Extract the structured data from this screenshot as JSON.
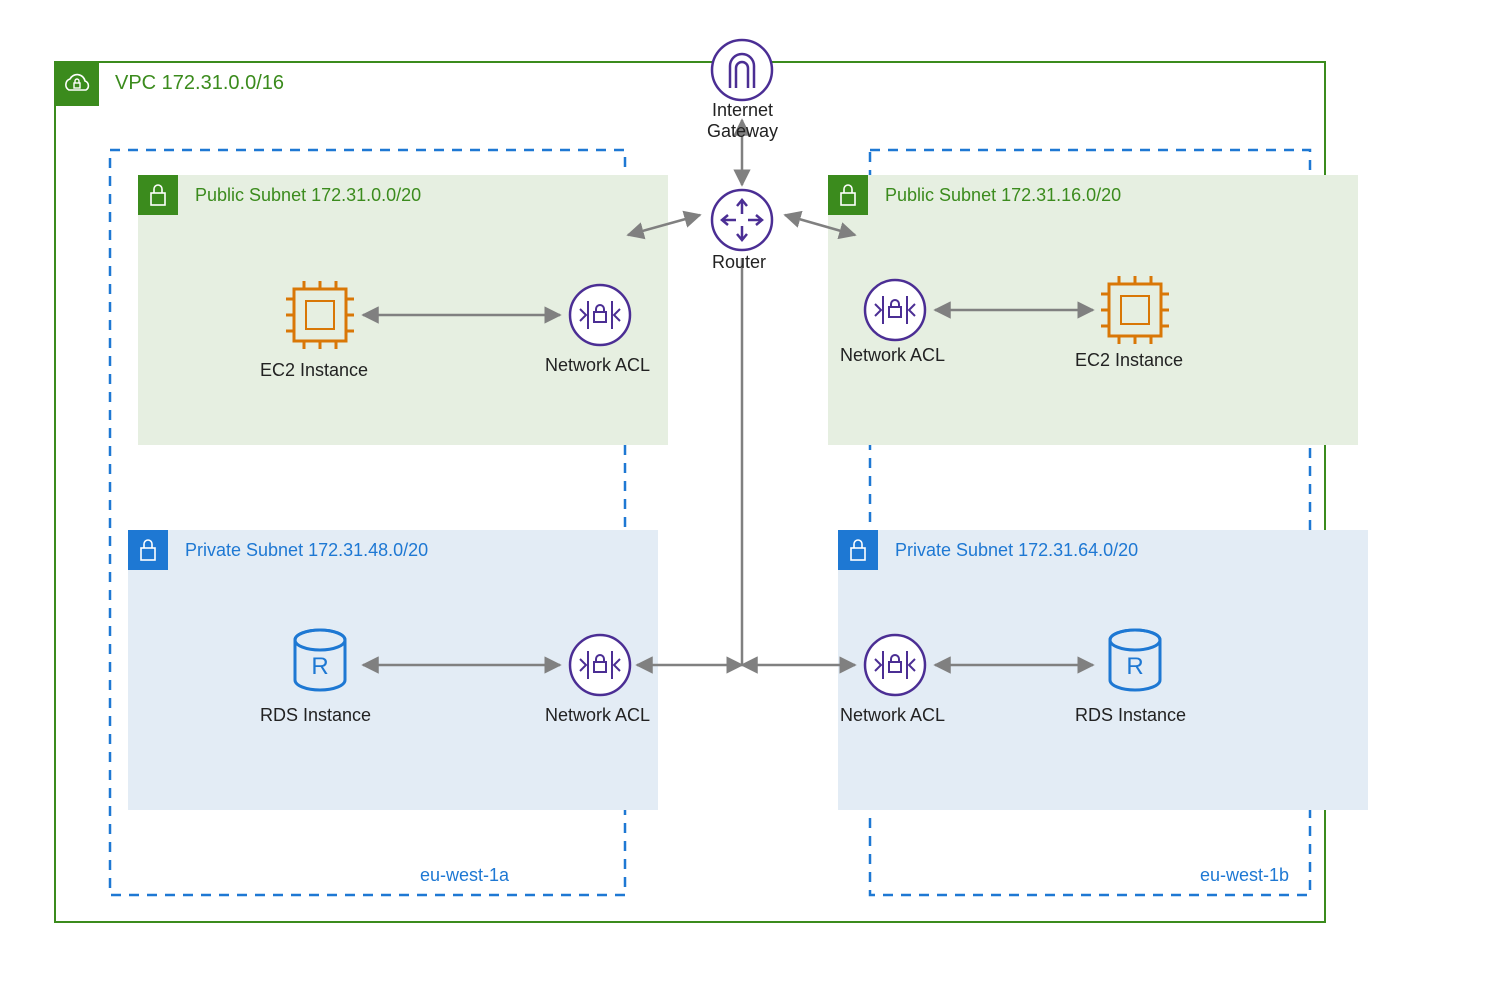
{
  "vpc": {
    "cidr": "VPC 172.31.0.0/16"
  },
  "gateway": {
    "label": "Internet\nGateway"
  },
  "router": {
    "label": "Router"
  },
  "az": {
    "left": "eu-west-1a",
    "right": "eu-west-1b"
  },
  "subnets": {
    "pub_left": {
      "label": "Public Subnet 172.31.0.0/20"
    },
    "pub_right": {
      "label": "Public Subnet 172.31.16.0/20"
    },
    "priv_left": {
      "label": "Private Subnet 172.31.48.0/20"
    },
    "priv_right": {
      "label": "Private Subnet 172.31.64.0/20"
    }
  },
  "components": {
    "ec2": "EC2 Instance",
    "nacl": "Network ACL",
    "rds": "RDS Instance"
  },
  "colors": {
    "green": "#3b8b1d",
    "blue": "#1e78d3",
    "purple": "#4b2e94",
    "orange": "#d97706",
    "paleGreen": "#e6efe1",
    "paleBlue": "#e3ecf5"
  },
  "chart_data": {
    "type": "diagram",
    "title": "AWS VPC architecture",
    "vpc_cidr": "172.31.0.0/16",
    "availability_zones": [
      "eu-west-1a",
      "eu-west-1b"
    ],
    "subnets": [
      {
        "name": "Public Subnet",
        "cidr": "172.31.0.0/20",
        "az": "eu-west-1a",
        "type": "public",
        "resources": [
          "EC2 Instance",
          "Network ACL"
        ]
      },
      {
        "name": "Public Subnet",
        "cidr": "172.31.16.0/20",
        "az": "eu-west-1b",
        "type": "public",
        "resources": [
          "Network ACL",
          "EC2 Instance"
        ]
      },
      {
        "name": "Private Subnet",
        "cidr": "172.31.48.0/20",
        "az": "eu-west-1a",
        "type": "private",
        "resources": [
          "RDS Instance",
          "Network ACL"
        ]
      },
      {
        "name": "Private Subnet",
        "cidr": "172.31.64.0/20",
        "az": "eu-west-1b",
        "type": "private",
        "resources": [
          "Network ACL",
          "RDS Instance"
        ]
      }
    ],
    "connections": [
      [
        "Internet Gateway",
        "Router"
      ],
      [
        "Router",
        "Network ACL (pub-left)"
      ],
      [
        "Router",
        "Network ACL (pub-right)"
      ],
      [
        "Router",
        "Network ACL (priv-left)"
      ],
      [
        "Router",
        "Network ACL (priv-right)"
      ],
      [
        "Network ACL (pub-left)",
        "EC2 Instance (pub-left)"
      ],
      [
        "Network ACL (pub-right)",
        "EC2 Instance (pub-right)"
      ],
      [
        "Network ACL (priv-left)",
        "RDS Instance (priv-left)"
      ],
      [
        "Network ACL (priv-right)",
        "RDS Instance (priv-right)"
      ]
    ]
  }
}
